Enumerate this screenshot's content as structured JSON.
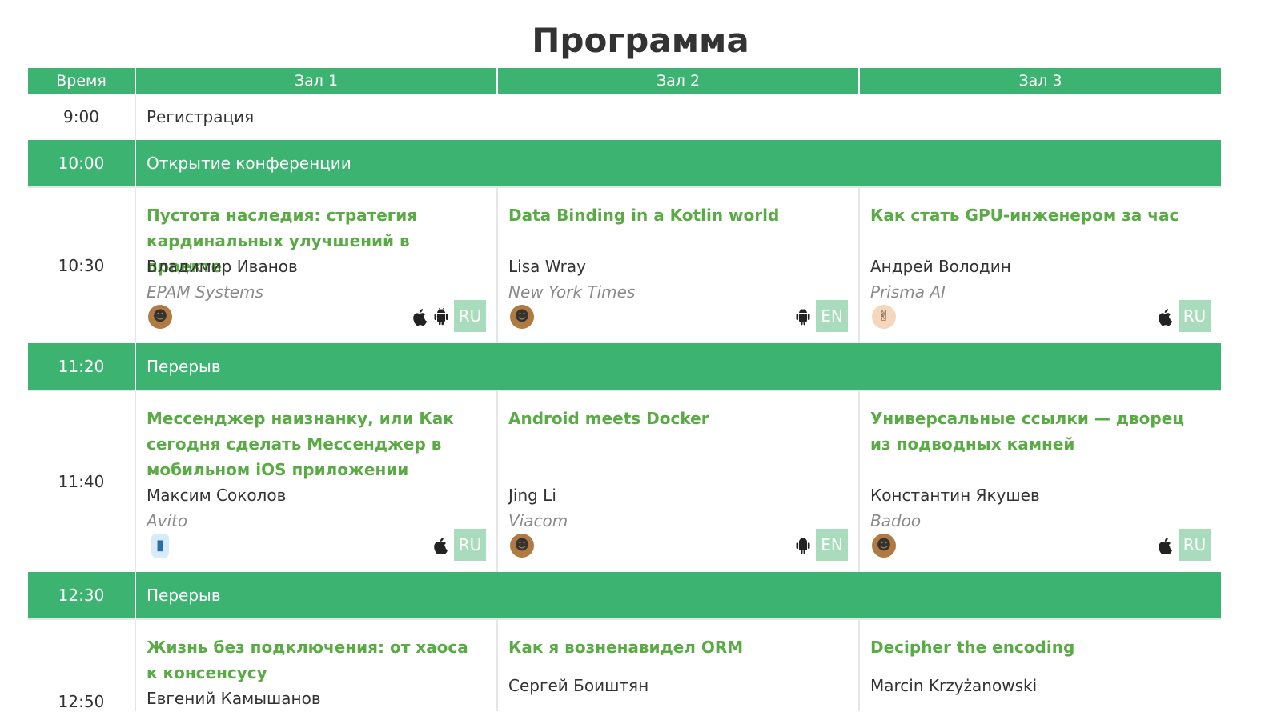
{
  "page_title": "Программа",
  "columns": [
    "Время",
    "Зал 1",
    "Зал 2",
    "Зал 3"
  ],
  "colors": {
    "accent": "#3cb371",
    "title_green": "#5aaa46",
    "lang_badge": "#a8dcbc",
    "company": "#8a8a8a"
  },
  "rows": {
    "r900": {
      "time": "9:00",
      "text": "Регистрация"
    },
    "r1000": {
      "time": "10:00",
      "text": "Открытие конференции"
    },
    "r1030": {
      "time": "10:30",
      "talks": [
        {
          "title": "Пустота наследия: стратегия кардинальных улучшений в проекте",
          "speaker": "Владимир Иванов",
          "company": "EPAM Systems",
          "lang": "RU",
          "platforms": [
            "apple-icon",
            "android-icon"
          ],
          "emoji": "bearded-face-icon"
        },
        {
          "title": "Data Binding in a Kotlin world",
          "speaker": "Lisa Wray",
          "company": "New York Times",
          "lang": "EN",
          "platforms": [
            "android-icon"
          ],
          "emoji": "bearded-face-icon"
        },
        {
          "title": "Как стать GPU-инженером за час",
          "speaker": "Андрей Володин",
          "company": "Prisma AI",
          "lang": "RU",
          "platforms": [
            "apple-icon"
          ],
          "emoji": "rock-hand-icon"
        }
      ]
    },
    "r1120": {
      "time": "11:20",
      "text": "Перерыв"
    },
    "r1140": {
      "time": "11:40",
      "talks": [
        {
          "title": "Мессенджер наизнанку, или Как сегодня сделать Мессенджер в мобильном iOS приложении",
          "speaker": "Максим Соколов",
          "company": "Avito",
          "lang": "RU",
          "platforms": [
            "apple-icon"
          ],
          "emoji": "cup-icon"
        },
        {
          "title": "Android meets Docker",
          "speaker": "Jing Li",
          "company": "Viacom",
          "lang": "EN",
          "platforms": [
            "android-icon"
          ],
          "emoji": "bearded-face-icon"
        },
        {
          "title": "Универсальные ссылки — дворец из подводных камней",
          "speaker": "Константин Якушев",
          "company": "Badoo",
          "lang": "RU",
          "platforms": [
            "apple-icon"
          ],
          "emoji": "bearded-face-icon"
        }
      ]
    },
    "r1230": {
      "time": "12:30",
      "text": "Перерыв"
    },
    "r1250": {
      "time": "12:50",
      "talks": [
        {
          "title": "Жизнь без подключения: от хаоса к консенсусу",
          "speaker": "Евгений Камышанов"
        },
        {
          "title": "Как я возненавидел ORM",
          "speaker": "Сергей Боиштян"
        },
        {
          "title": "Decipher the encoding",
          "speaker": "Marcin Krzyżanowski"
        }
      ]
    }
  }
}
